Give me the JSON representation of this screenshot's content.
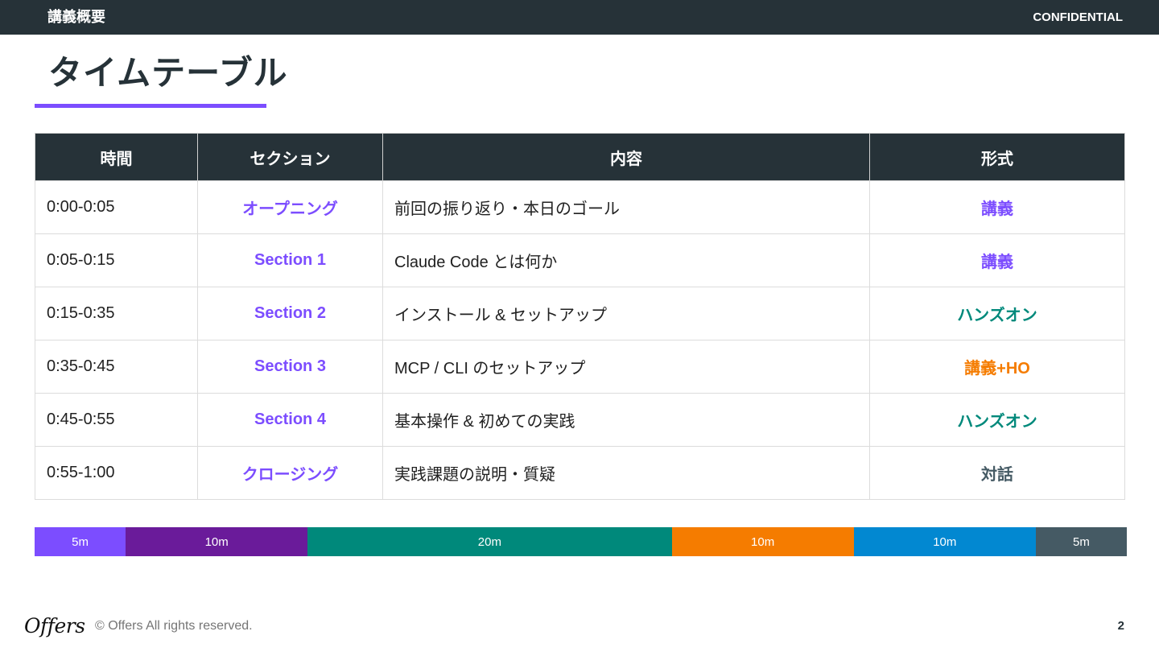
{
  "header": {
    "left_label": "講義概要",
    "right_label": "CONFIDENTIAL"
  },
  "title": "タイムテーブル",
  "colors": {
    "accent": "#7c4dff",
    "header_bg": "#263238",
    "format_lecture": "#7c4dff",
    "format_handson": "#00897b",
    "format_mixed": "#f57c00",
    "format_dialogue": "#455a64"
  },
  "table": {
    "headers": [
      "時間",
      "セクション",
      "内容",
      "形式"
    ],
    "rows": [
      {
        "time": "0:00-0:05",
        "section": "オープニング",
        "content": "前回の振り返り・本日のゴール",
        "format": "講義",
        "format_color": "#7c4dff"
      },
      {
        "time": "0:05-0:15",
        "section": "Section 1",
        "content": "Claude Code とは何か",
        "format": "講義",
        "format_color": "#7c4dff"
      },
      {
        "time": "0:15-0:35",
        "section": "Section 2",
        "content": "インストール & セットアップ",
        "format": "ハンズオン",
        "format_color": "#00897b"
      },
      {
        "time": "0:35-0:45",
        "section": "Section 3",
        "content": "MCP / CLI のセットアップ",
        "format": "講義+HO",
        "format_color": "#f57c00"
      },
      {
        "time": "0:45-0:55",
        "section": "Section 4",
        "content": "基本操作 & 初めての実践",
        "format": "ハンズオン",
        "format_color": "#00897b"
      },
      {
        "time": "0:55-1:00",
        "section": "クロージング",
        "content": "実践課題の説明・質疑",
        "format": "対話",
        "format_color": "#455a64"
      }
    ]
  },
  "timeline": {
    "segments": [
      {
        "label": "5m",
        "minutes": 5,
        "color": "#7c4dff"
      },
      {
        "label": "10m",
        "minutes": 10,
        "color": "#6a1b9a"
      },
      {
        "label": "20m",
        "minutes": 20,
        "color": "#00897b"
      },
      {
        "label": "10m",
        "minutes": 10,
        "color": "#f57c00"
      },
      {
        "label": "10m",
        "minutes": 10,
        "color": "#0288d1"
      },
      {
        "label": "5m",
        "minutes": 5,
        "color": "#455a64"
      }
    ]
  },
  "footer": {
    "logo_text": "Offers",
    "copyright": "© Offers All rights reserved.",
    "page_number": "2"
  }
}
